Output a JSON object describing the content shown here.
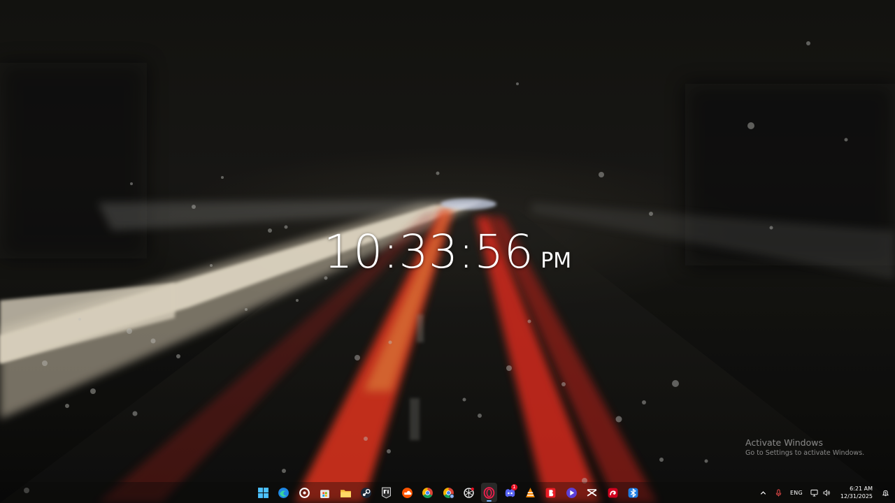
{
  "clock": {
    "time": "10:33:56",
    "ampm": "PM"
  },
  "watermark": {
    "title": "Activate Windows",
    "subtitle": "Go to Settings to activate Windows."
  },
  "taskbar": {
    "apps": [
      "start-icon",
      "edge-icon",
      "steelseries-icon",
      "microsoft-store-icon",
      "file-explorer-icon",
      "steam-icon",
      "epic-games-icon",
      "soundcloud-icon",
      "chrome-icon",
      "chrome-icon",
      "chatgpt-icon",
      "opera-gx-icon",
      "discord-icon",
      "vlc-icon",
      "bitdefender-icon",
      "media-player-icon",
      "capcut-icon",
      "rog-icon",
      "bluetooth-app-icon"
    ],
    "discord_badge": "1",
    "tray": {
      "lang": "ENG",
      "time": "6:21 AM",
      "date": "12/31/2025"
    }
  },
  "colors": {
    "accent": "#0078d4",
    "taillight": "#ff3a22",
    "headlight": "#fff2d6"
  }
}
